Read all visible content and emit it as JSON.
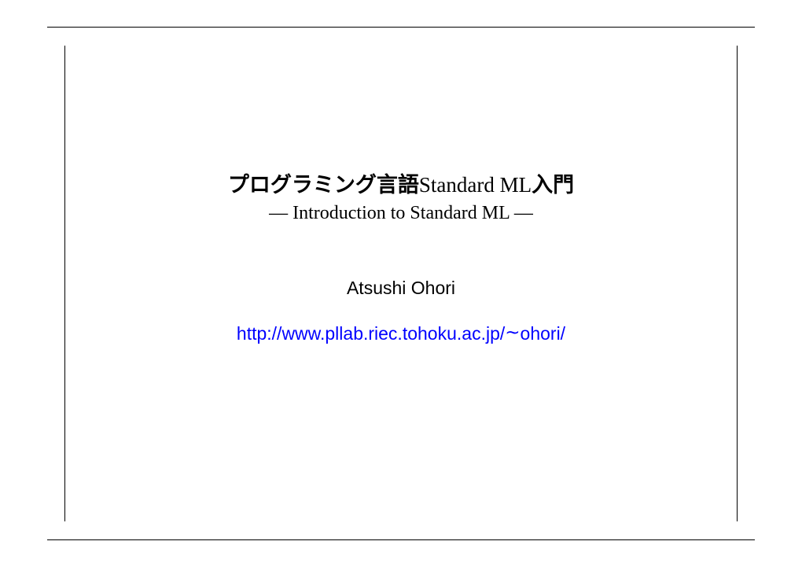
{
  "title": {
    "jp_prefix": "プログラミング言語",
    "en_mid": "Standard ML",
    "jp_suffix": "入門",
    "subtitle": "— Introduction to Standard ML —"
  },
  "author": "Atsushi Ohori",
  "url": {
    "prefix": "http://www.pllab.riec.tohoku.ac.jp/",
    "tilde": "∼",
    "suffix": "ohori/"
  },
  "colors": {
    "link": "#0000ff",
    "text": "#000000"
  }
}
